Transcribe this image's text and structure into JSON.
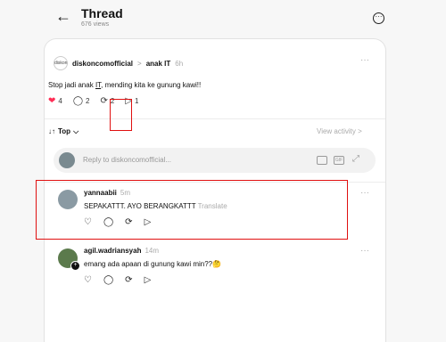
{
  "header": {
    "title": "Thread",
    "views": "676 views",
    "back_icon": "arrow-left-icon",
    "more_icon": "more-circle-icon"
  },
  "post": {
    "avatar_text": "diskon",
    "author": "diskoncomofficial",
    "separator": ">",
    "community": "anak IT",
    "time": "6h",
    "more": "···",
    "text_before": "Stop jadi anak ",
    "text_link": "IT",
    "text_after": ", mending kita ke gunung kawi!!",
    "likes": "4",
    "comments": "2",
    "reposts": "2",
    "shares": "1"
  },
  "sort": {
    "label": "Top",
    "chevron": "⌵",
    "view_activity": "View activity >"
  },
  "reply": {
    "placeholder": "Reply to diskoncomofficial...",
    "gif": "GIF"
  },
  "comments": [
    {
      "author": "yannaabii",
      "time": "5m",
      "text": "SEPAKATTT. AYO BERANGKATTT",
      "translate": "Translate",
      "more": "···"
    },
    {
      "author": "agil.wadriansyah",
      "time": "14m",
      "text": "emang ada apaan di gunung kawi min??🤔",
      "more": "···"
    }
  ],
  "colors": {
    "like_red": "#ff2d55",
    "highlight": "#e01010"
  }
}
